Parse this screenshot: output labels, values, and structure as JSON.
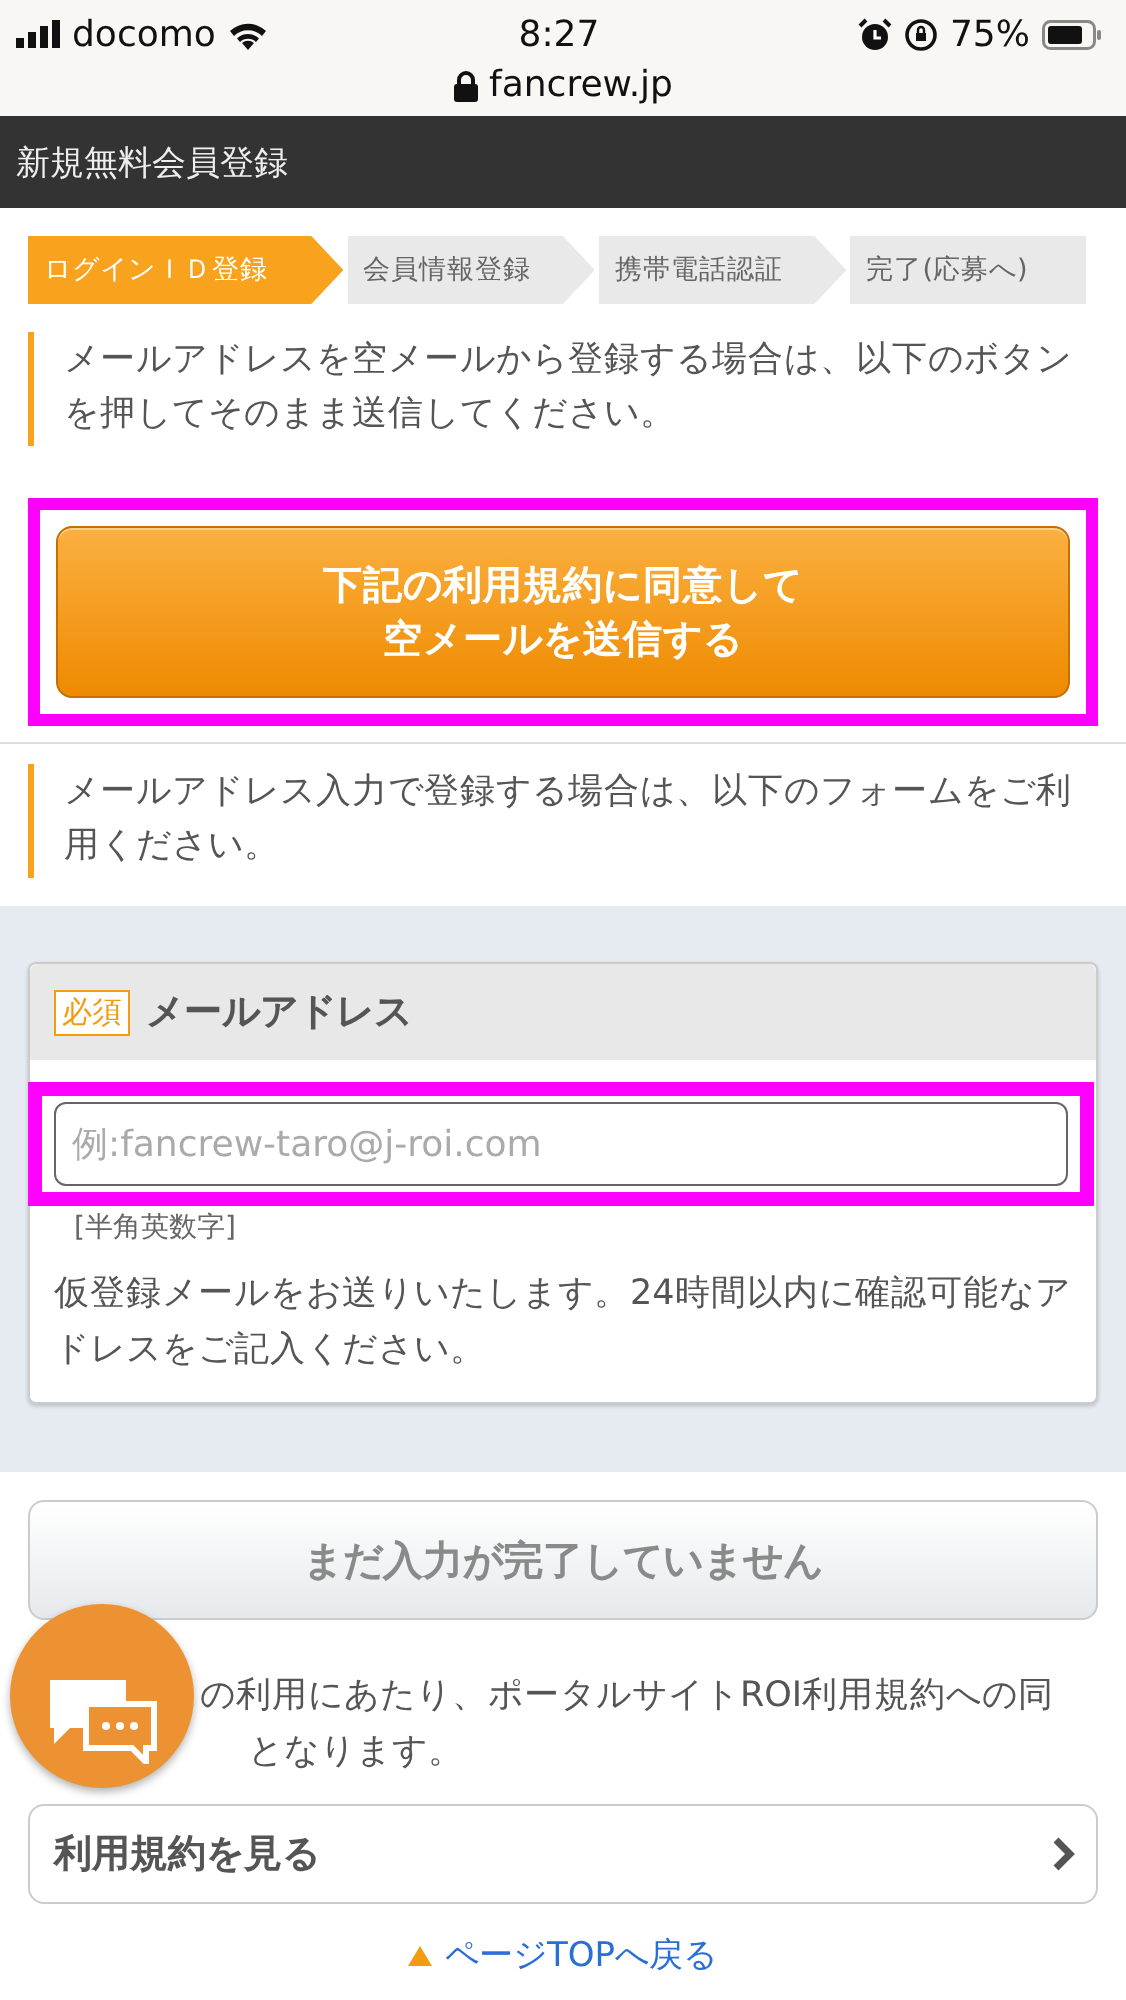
{
  "status_bar": {
    "carrier": "docomo",
    "time": "8:27",
    "battery": "75%"
  },
  "address_bar": {
    "url": "fancrew.jp"
  },
  "header": {
    "title": "新規無料会員登録"
  },
  "steps": [
    {
      "label": "ログインＩＤ登録",
      "selected": true
    },
    {
      "label": "会員情報登録",
      "selected": false
    },
    {
      "label": "携帯電話認証",
      "selected": false
    },
    {
      "label": "完了(応募へ)",
      "selected": false
    }
  ],
  "mail_option": {
    "note": "メールアドレスを空メールから登録する場合は、以下のボタンを押してそのまま送信してください。",
    "button": "下記の利用規約に同意して空メールを送信する"
  },
  "form_option": {
    "note": "メールアドレス入力で登録する場合は、以下のフォームをご利用ください。"
  },
  "email_field": {
    "required_badge": "必須",
    "label": "メールアドレス",
    "placeholder": "例:fancrew-taro@j-roi.com",
    "hint": "[半角英数字]",
    "description": "仮登録メールをお送りいたします。24時間以内に確認可能なアドレスをご記入ください。"
  },
  "submit_button": {
    "label": "まだ入力が完了していません",
    "disabled": true
  },
  "terms_note": [
    "の利用にあたり、ポータルサイトROI利用規約への同",
    "となります。"
  ],
  "terms_link": {
    "label": "利用規約を見る"
  },
  "page_top_link": {
    "label": "ページTOPへ戻る"
  }
}
